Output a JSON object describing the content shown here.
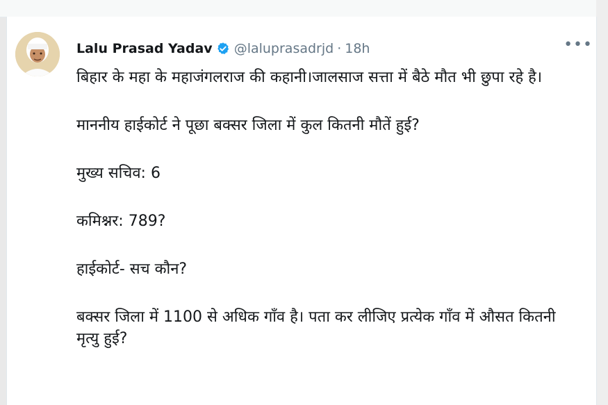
{
  "author": {
    "display_name": "Lalu Prasad Yadav",
    "handle": "@laluprasadrjd",
    "separator": "·",
    "time": "18h",
    "verified_icon": "verified-badge-icon",
    "avatar_icon": "user-avatar"
  },
  "menu": {
    "more_label": "•••"
  },
  "tweet": {
    "paragraphs": [
      "बिहार के महा के महाजंगलराज की कहानी।जालसाज सत्ता में बैठे मौत भी छुपा रहे है।",
      "माननीय हाईकोर्ट ने पूछा बक्सर जिला में कुल कितनी मौतें हुई?",
      "मुख्य सचिव: 6",
      "कमिश्नर: 789?",
      "हाईकोर्ट- सच कौन?",
      "बक्सर जिला में 1100 से अधिक गाँव है। पता कर लीजिए प्रत्येक गाँव में औसत कितनी मृत्यु हुई?"
    ]
  },
  "colors": {
    "name": "#14171a",
    "secondary": "#657786",
    "verified": "#1da1f2",
    "background": "#ffffff"
  }
}
